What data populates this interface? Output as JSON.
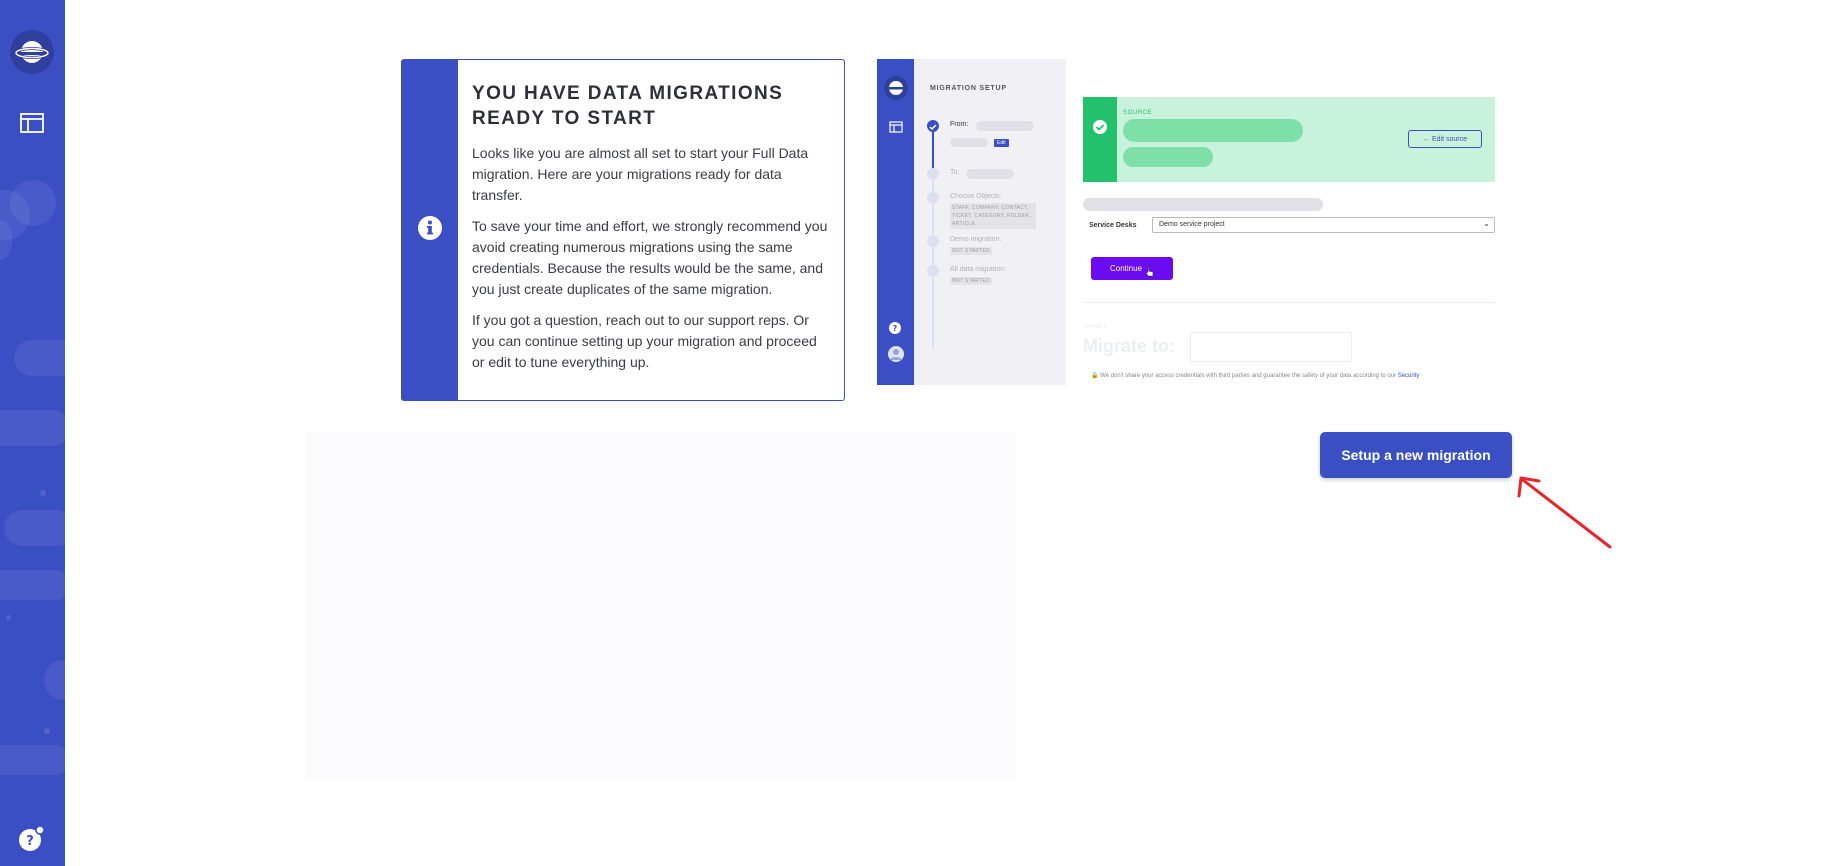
{
  "info_card": {
    "title": "YOU HAVE DATA MIGRATIONS READY TO START",
    "paragraphs": [
      "Looks like you are almost all set to start your Full Data migration. Here are your migrations ready for data transfer.",
      "To save your time and effort, we strongly recommend you avoid creating numerous migrations using the same credentials. Because the results would be the same, and you just create duplicates of the same migration.",
      "If you got a question, reach out to our support reps. Or you can continue setting up your migration and proceed or edit to tune everything up."
    ]
  },
  "preview": {
    "header": "MIGRATION SETUP",
    "steps": {
      "from": "From:",
      "edit_tag": "Edit",
      "to": "To:",
      "choose_objects": "Choose Objects:",
      "objects_list": "STAFF, COMPANY, CONTACT, TICKET, CATEGORY, FOLDER, ARTICLE",
      "demo": "Demo migration:",
      "demo_status": "NOT STARTED",
      "all_data": "All data migration:",
      "all_data_status": "NOT STARTED"
    },
    "source_label": "SOURCE",
    "edit_source": "← Edit source",
    "service_desks_label": "Service Desks",
    "service_desks_value": "Demo service project",
    "continue_label": "Continue",
    "target_label": "TARGET",
    "migrate_to": "Migrate to:",
    "security_note_prefix": "We don't share your access credentials with third parties and guarantee the safety of your data according to our ",
    "security_note_link": "Security"
  },
  "actions": {
    "setup_new_migration": "Setup a new migration"
  },
  "colors": {
    "brand": "#3b4fc4",
    "success": "#21c26b",
    "continue": "#6a0bf0",
    "annotation_arrow": "#e8242b"
  },
  "icons": {
    "logo": "planet-logo-icon",
    "nav": "dashboard-icon",
    "help": "help-icon",
    "info": "info-icon"
  }
}
